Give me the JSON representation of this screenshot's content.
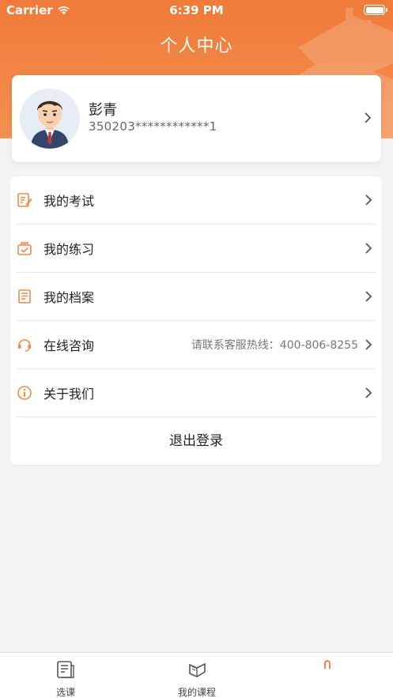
{
  "status_bar": {
    "carrier": "Carrier",
    "time": "6:39 PM"
  },
  "header": {
    "title": "个人中心"
  },
  "profile": {
    "name": "彭青",
    "id_masked": "350203************1"
  },
  "menu": {
    "items": [
      {
        "label": "我的考试",
        "icon": "exam-icon"
      },
      {
        "label": "我的练习",
        "icon": "practice-icon"
      },
      {
        "label": "我的档案",
        "icon": "archive-icon"
      },
      {
        "label": "在线咨询",
        "icon": "headset-icon",
        "extra": "请联系客服热线：400-806-8255"
      },
      {
        "label": "关于我们",
        "icon": "info-icon"
      }
    ],
    "logout_label": "退出登录"
  },
  "tabbar": {
    "tabs": [
      {
        "label": "选课",
        "icon": "course-select-icon"
      },
      {
        "label": "我的课程",
        "icon": "my-courses-icon"
      },
      {
        "label": "",
        "icon": "profile-tab-icon"
      }
    ]
  },
  "colors": {
    "accent": "#f07a3a",
    "icon_orange": "#f08a4b"
  }
}
